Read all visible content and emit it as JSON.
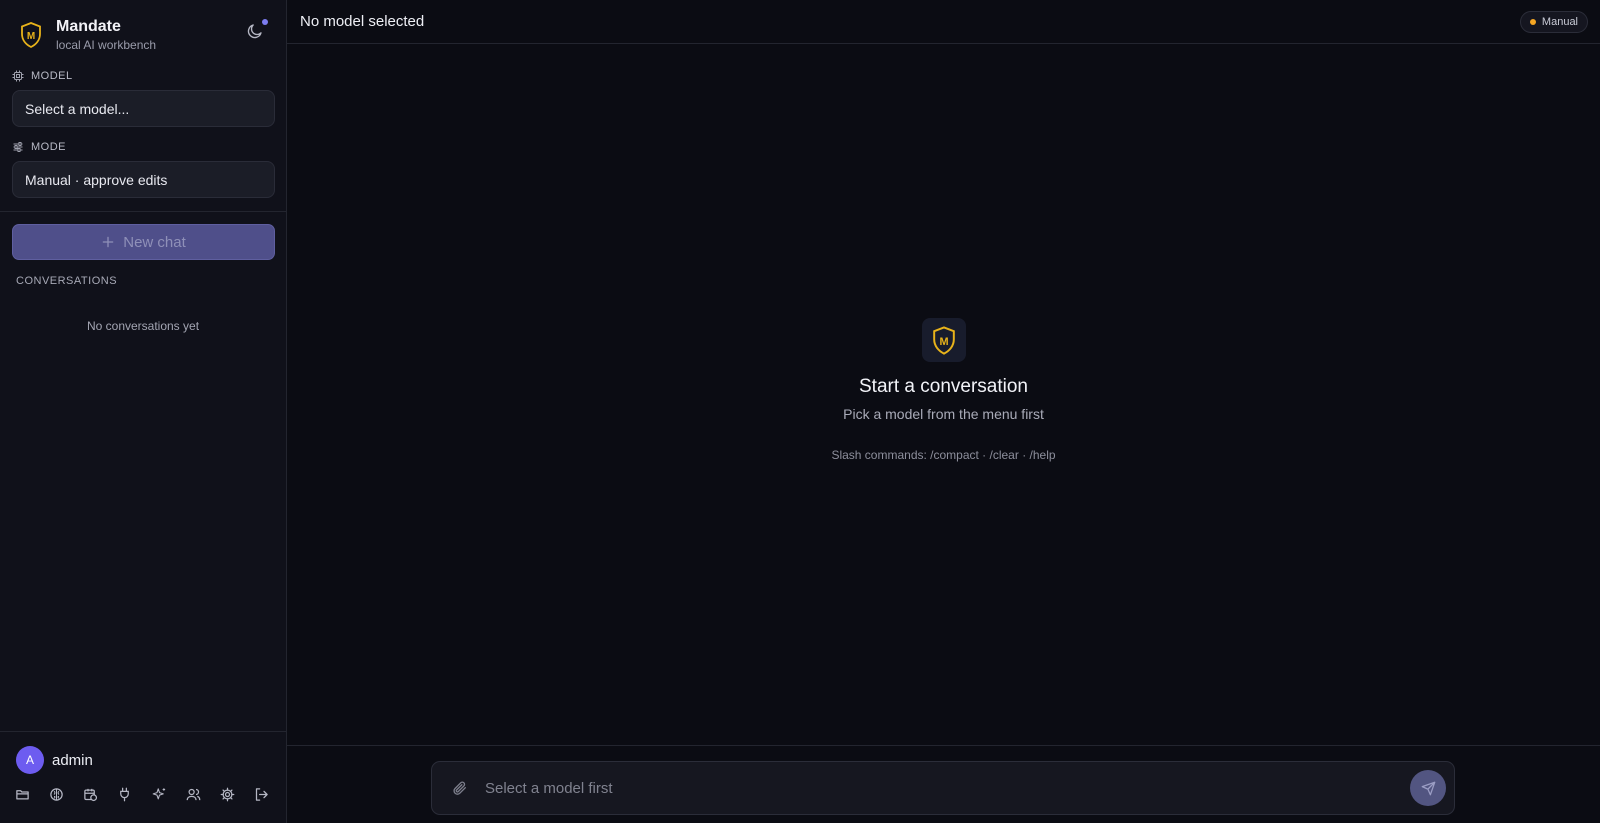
{
  "brand": {
    "name": "Mandate",
    "subtitle": "local AI workbench",
    "logo_letter": "M"
  },
  "sidebar": {
    "model_label": "MODEL",
    "model_value": "Select a model...",
    "mode_label": "MODE",
    "mode_value": "Manual · approve edits",
    "new_chat_label": "New chat",
    "conversations_label": "CONVERSATIONS",
    "empty_conversations": "No conversations yet"
  },
  "user": {
    "avatar_initial": "A",
    "name": "admin"
  },
  "toolbar_icons": [
    "folder-icon",
    "brain-icon",
    "calendar-clock-icon",
    "plug-icon",
    "sparkles-icon",
    "users-icon",
    "settings-icon",
    "logout-icon"
  ],
  "header": {
    "title": "No model selected",
    "mode_badge": "Manual"
  },
  "empty_state": {
    "title": "Start a conversation",
    "subtitle": "Pick a model from the menu first",
    "hint": "Slash commands: /compact · /clear · /help"
  },
  "composer": {
    "placeholder": "Select a model first"
  },
  "colors": {
    "accent": "#6d5cf0",
    "logo_gold": "#e8b31a",
    "badge_dot": "#f5a623",
    "new_chat_bg": "#4f4f8a"
  }
}
